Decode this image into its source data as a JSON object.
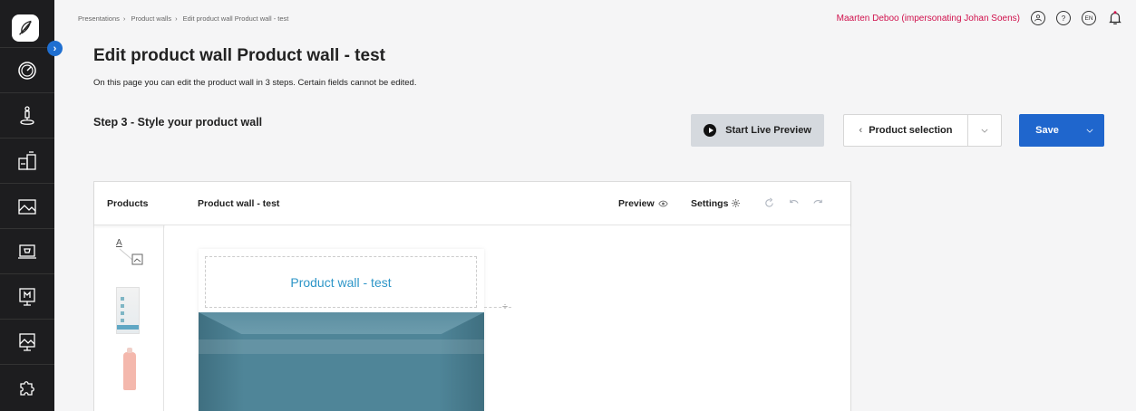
{
  "breadcrumb": [
    "Presentations",
    "Product walls",
    "Edit product wall Product wall - test"
  ],
  "user": {
    "name": "Maarten Deboo (impersonating Johan Soens)",
    "lang": "EN",
    "help": "?"
  },
  "page": {
    "title": "Edit product wall Product wall - test",
    "subtitle": "On this page you can edit the product wall in 3 steps. Certain fields cannot be edited.",
    "step": "Step 3 - Style your product wall"
  },
  "actions": {
    "live_preview": "Start Live Preview",
    "product_selection": "Product selection",
    "save": "Save"
  },
  "editor": {
    "products_label": "Products",
    "wall_name": "Product wall - test",
    "preview_label": "Preview",
    "settings_label": "Settings",
    "canvas_title": "Product wall - test",
    "text_tool_letter": "A"
  },
  "sidebar": {
    "icons": [
      "dashboard-icon",
      "presenter-icon",
      "products-icon",
      "image-gallery-icon",
      "shop-screen-icon",
      "display-m-icon",
      "presentation-icon",
      "puzzle-icon"
    ]
  },
  "colors": {
    "accent": "#1f66cd",
    "user_name": "#d0104c",
    "wall_title": "#2e96c8",
    "wall_body": "#4f8598"
  }
}
